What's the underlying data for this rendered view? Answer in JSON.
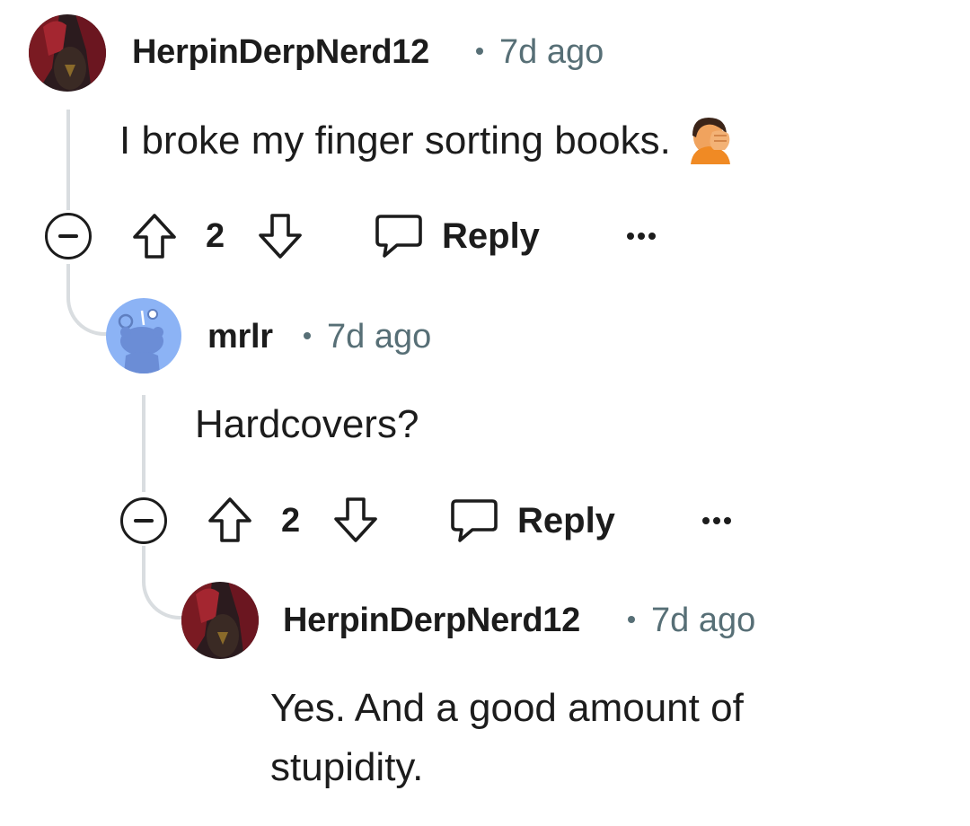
{
  "colors": {
    "text": "#1c1c1c",
    "meta": "#576f76",
    "thread_line": "#d9dde0",
    "snoo_bg": "#8cb3f5",
    "emoji_orange": "#f08a24"
  },
  "comments": [
    {
      "username": "HerpinDerpNerd12",
      "time": "7d ago",
      "body_lines": [
        "I broke my finger sorting books."
      ],
      "emoji": "face-palm-emoji",
      "score": "2",
      "reply_label": "Reply",
      "avatar": "dark-red-hair-avatar"
    },
    {
      "username": "mrlr",
      "time": "7d ago",
      "body_lines": [
        "Hardcovers?"
      ],
      "score": "2",
      "reply_label": "Reply",
      "avatar": "snoo-avatar"
    },
    {
      "username": "HerpinDerpNerd12",
      "time": "7d ago",
      "body_lines": [
        "Yes. And a good amount of",
        "stupidity."
      ],
      "avatar": "dark-red-hair-avatar"
    }
  ],
  "icons": {
    "collapse": "minus-circle-icon",
    "upvote": "arrow-up-icon",
    "downvote": "arrow-down-icon",
    "reply": "speech-bubble-icon",
    "more": "ellipsis-icon"
  }
}
